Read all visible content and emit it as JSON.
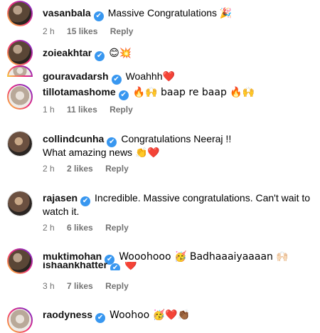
{
  "comments": [
    {
      "username": "vasanbala",
      "text": "Massive Congratulations 🎉",
      "time": "2 h",
      "likes": "15 likes",
      "reply": "Reply"
    },
    {
      "username": "zoieakhtar",
      "text": "😊💥"
    },
    {
      "username": "gouravadarsh",
      "text": "Woahhh❤️"
    },
    {
      "username": "tillotamashome",
      "text": "🔥🙌 baap re baap 🔥🙌",
      "time": "1 h",
      "likes": "11 likes",
      "reply": "Reply"
    },
    {
      "username": "collindcunha",
      "text": "Congratulations Neeraj !!",
      "text2": "What amazing news 👏❤️",
      "time": "2 h",
      "likes": "2 likes",
      "reply": "Reply"
    },
    {
      "username": "rajasen",
      "text": "Incredible. Massive congratulations. Can't wait to",
      "text2": "watch it.",
      "time": "2 h",
      "likes": "6 likes",
      "reply": "Reply"
    },
    {
      "username": "muktimohan",
      "text": "Wooohooo 🥳 Badhaaaiyaaaan 🙌🏻"
    },
    {
      "username": "ishaankhatter",
      "text": "❤️",
      "time": "3 h",
      "likes": "7 likes",
      "reply": "Reply"
    },
    {
      "username": "raodyness",
      "text": "Woohoo 🥳❤️👏🏾"
    }
  ],
  "verified_mark": "✔"
}
